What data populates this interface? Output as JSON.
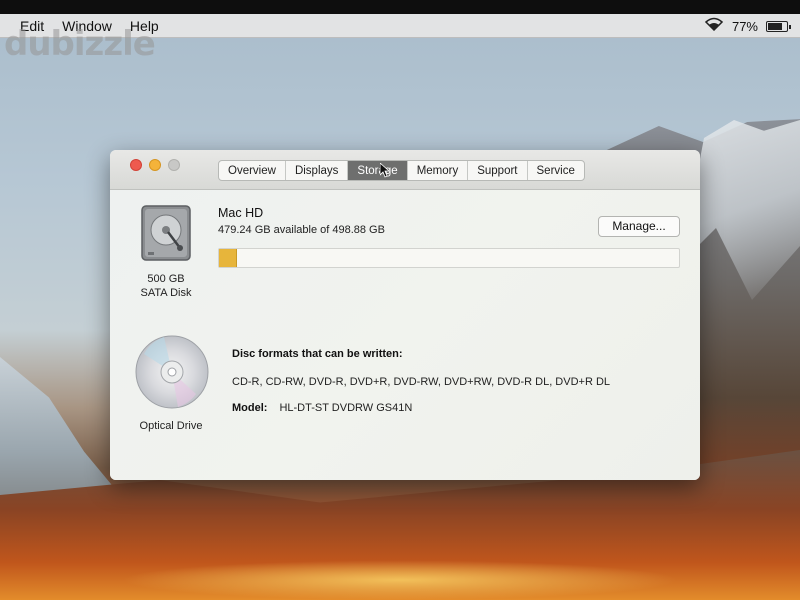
{
  "menubar": {
    "items": [
      "Edit",
      "Window",
      "Help"
    ],
    "battery_percent": "77%"
  },
  "watermark": "dubizzle",
  "window": {
    "tabs": [
      {
        "label": "Overview",
        "active": false
      },
      {
        "label": "Displays",
        "active": false
      },
      {
        "label": "Storage",
        "active": true
      },
      {
        "label": "Memory",
        "active": false
      },
      {
        "label": "Support",
        "active": false
      },
      {
        "label": "Service",
        "active": false
      }
    ],
    "disk": {
      "size_label": "500 GB",
      "type_label": "SATA Disk",
      "icon": "hard-drive-icon",
      "volume_name": "Mac HD",
      "availability": "479.24 GB available of 498.88 GB",
      "used_fraction": 0.04,
      "used_color": "#e7b53b",
      "manage_label": "Manage..."
    },
    "optical": {
      "label": "Optical Drive",
      "icon": "optical-disc-icon",
      "formats_title": "Disc formats that can be written:",
      "formats": "CD-R, CD-RW, DVD-R, DVD+R, DVD-RW, DVD+RW, DVD-R DL, DVD+R DL",
      "model_label": "Model:",
      "model_value": "HL-DT-ST DVDRW GS41N"
    }
  }
}
